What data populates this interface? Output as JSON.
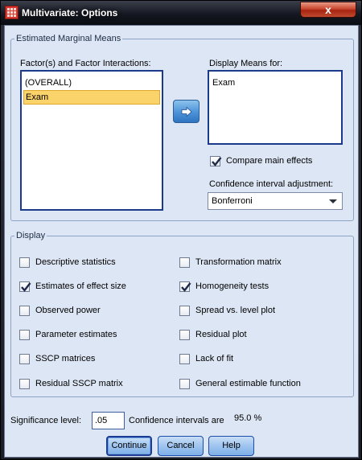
{
  "window": {
    "title": "Multivariate: Options",
    "close_glyph": "x"
  },
  "emm": {
    "legend": "Estimated Marginal Means",
    "factors_label": "Factor(s) and Factor Interactions:",
    "factors": [
      "(OVERALL)",
      "Exam"
    ],
    "selected_factor": "Exam",
    "display_label": "Display Means for:",
    "display_items": [
      "Exam"
    ],
    "move_button_icon": "right-arrow-icon",
    "compare_label": "Compare main effects",
    "compare_checked": true,
    "ci_label": "Confidence interval adjustment:",
    "ci_value": "Bonferroni"
  },
  "display": {
    "legend": "Display",
    "left": [
      {
        "label": "Descriptive statistics",
        "checked": false
      },
      {
        "label": "Estimates of effect size",
        "checked": true
      },
      {
        "label": "Observed power",
        "checked": false
      },
      {
        "label": "Parameter estimates",
        "checked": false
      },
      {
        "label": "SSCP matrices",
        "checked": false
      },
      {
        "label": "Residual SSCP matrix",
        "checked": false
      }
    ],
    "right": [
      {
        "label": "Transformation matrix",
        "checked": false
      },
      {
        "label": "Homogeneity tests",
        "checked": true
      },
      {
        "label": "Spread vs. level plot",
        "checked": false
      },
      {
        "label": "Residual plot",
        "checked": false
      },
      {
        "label": "Lack of fit",
        "checked": false
      },
      {
        "label": "General estimable function",
        "checked": false
      }
    ]
  },
  "significance": {
    "label": "Significance level:",
    "value": ".05",
    "ci_text": "Confidence intervals are",
    "ci_value": "95.0 %"
  },
  "buttons": {
    "continue": "Continue",
    "cancel": "Cancel",
    "help": "Help"
  },
  "colors": {
    "client_bg": "#dde6f4",
    "selection": "#fbd36b",
    "accent": "#1b3a8a",
    "close": "#c9462e"
  }
}
